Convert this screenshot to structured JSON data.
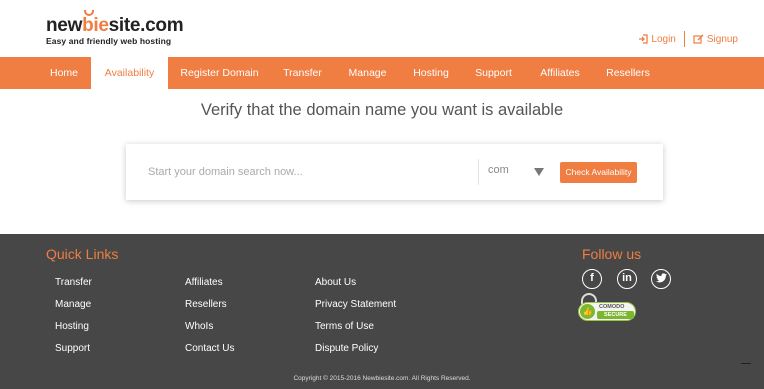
{
  "brand": {
    "name_part1": "new",
    "name_part2": "bie",
    "name_part3": "site.com",
    "tagline": "Easy and friendly web hosting"
  },
  "auth": {
    "login": "Login",
    "signup": "Signup"
  },
  "nav": {
    "items": [
      {
        "label": "Home",
        "active": false
      },
      {
        "label": "Availability",
        "active": true
      },
      {
        "label": "Register Domain",
        "active": false
      },
      {
        "label": "Transfer",
        "active": false
      },
      {
        "label": "Manage",
        "active": false
      },
      {
        "label": "Hosting",
        "active": false
      },
      {
        "label": "Support",
        "active": false
      },
      {
        "label": "Affiliates",
        "active": false
      },
      {
        "label": "Resellers",
        "active": false
      }
    ]
  },
  "main": {
    "headline": "Verify that the domain name you want is available",
    "search_placeholder": "Start your domain search now...",
    "tld": "com",
    "check_button": "Check Availability"
  },
  "footer": {
    "quick_links_title": "Quick Links",
    "follow_title": "Follow us",
    "col1": [
      "Transfer",
      "Manage",
      "Hosting",
      "Support"
    ],
    "col2": [
      "Affiliates",
      "Resellers",
      "WhoIs",
      "Contact Us"
    ],
    "col3": [
      "About Us",
      "Privacy Statement",
      "Terms of Use",
      "Dispute Policy"
    ],
    "social": {
      "facebook": "f",
      "linkedin": "in",
      "twitter": "t"
    },
    "badge_top": "COMODO",
    "badge_bottom": "SECURE",
    "copyright": "Copyright © 2015-2016 Newbiesite.com. All Rights Reserved."
  },
  "colors": {
    "accent": "#f07d42",
    "footer_bg": "#474747"
  }
}
